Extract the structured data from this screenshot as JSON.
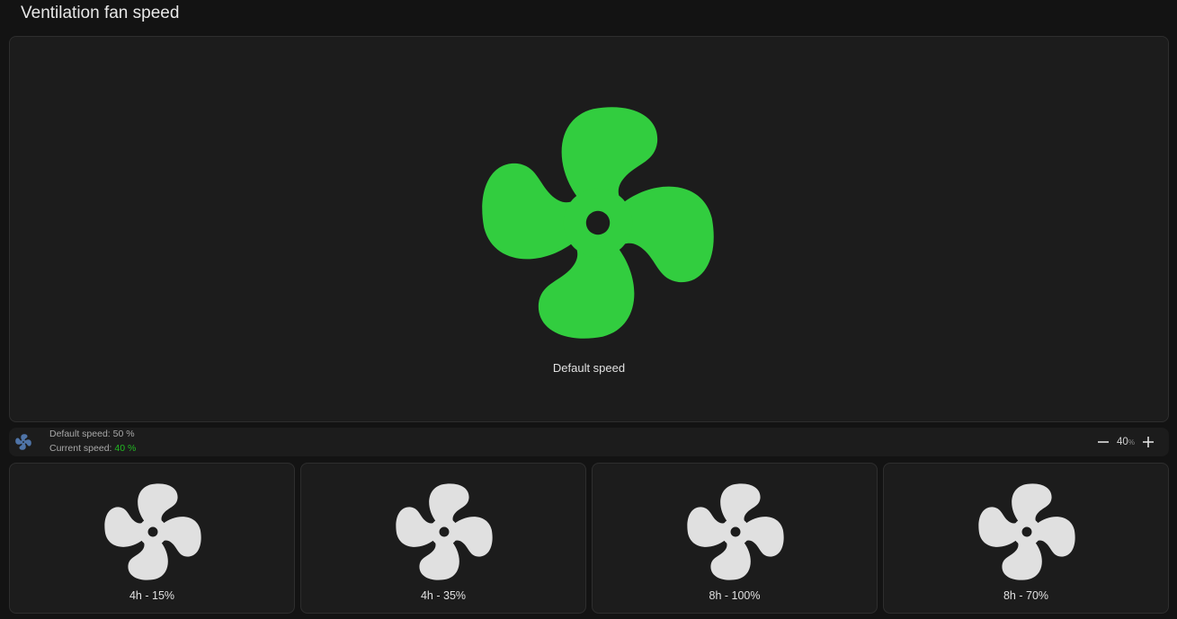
{
  "page": {
    "title": "Ventilation fan speed"
  },
  "main": {
    "label": "Default speed",
    "fan_icon": "fan-icon",
    "fan_color": "#32cd3f"
  },
  "status": {
    "icon": "fan-icon",
    "icon_color": "#4f74a8",
    "default_speed_label": "Default speed:",
    "default_speed_value": "50 %",
    "current_speed_label": "Current speed:",
    "current_speed_value": "40 %",
    "current_speed_color": "#22b822"
  },
  "stepper": {
    "value": "40",
    "unit": "%",
    "minus_icon": "minus-icon",
    "plus_icon": "plus-icon"
  },
  "presets": [
    {
      "label": "4h - 15%",
      "icon": "fan-icon"
    },
    {
      "label": "4h - 35%",
      "icon": "fan-icon"
    },
    {
      "label": "8h - 100%",
      "icon": "fan-icon"
    },
    {
      "label": "8h - 70%",
      "icon": "fan-icon"
    }
  ],
  "colors": {
    "background": "#131313",
    "card": "#1c1c1c",
    "preset_fan": "#e0e0e0"
  }
}
